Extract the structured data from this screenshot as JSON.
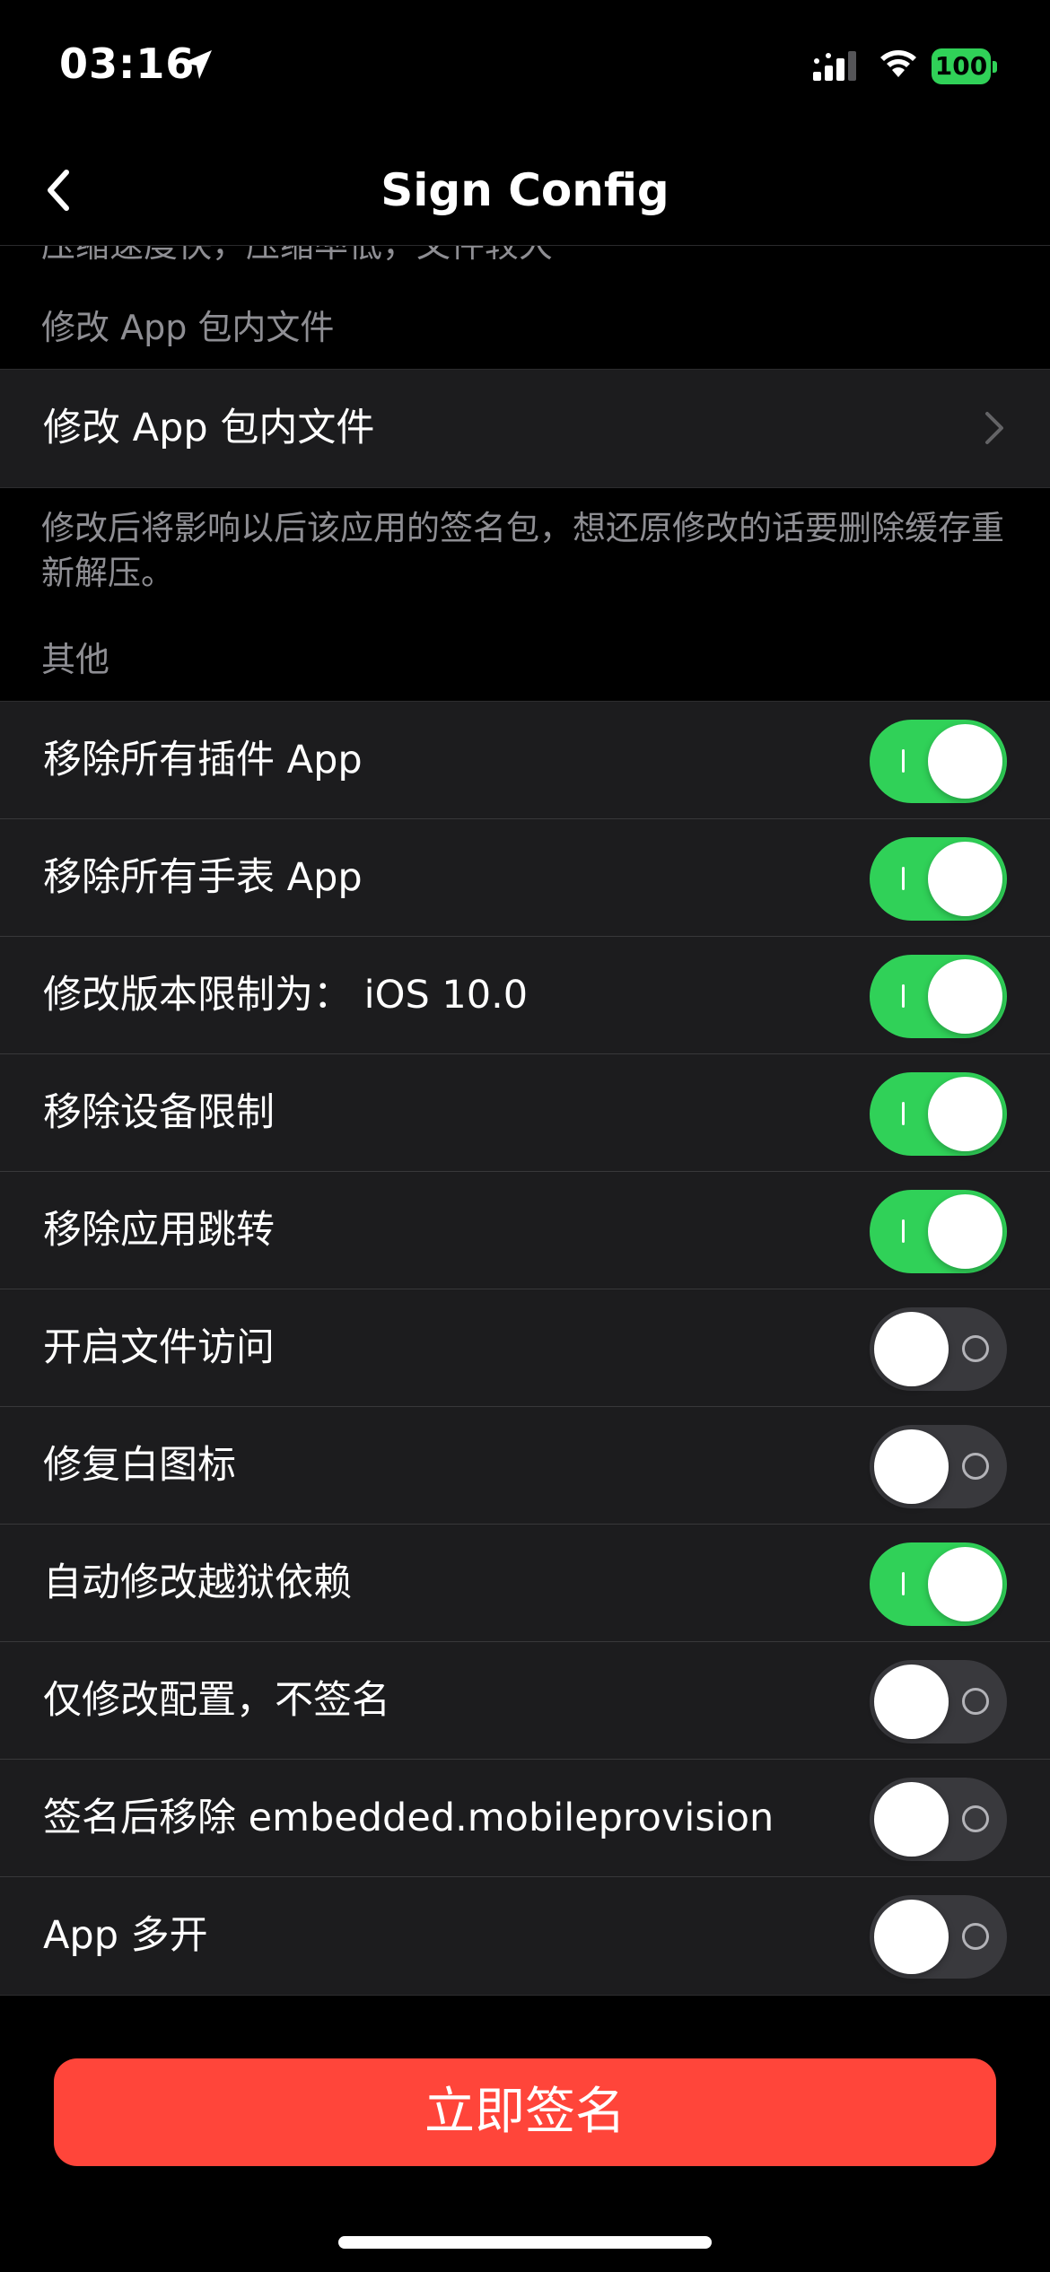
{
  "status_bar": {
    "time": "03:16",
    "battery": "100",
    "battery_color": "#30d158"
  },
  "nav": {
    "title": "Sign Config",
    "back_icon": "chevron-left-icon"
  },
  "sections": {
    "previous_footer": "压缩速度快，压缩率低，文件较大",
    "modify_header": "修改 App 包内文件",
    "modify_row_label": "修改 App 包内文件",
    "modify_footer": "修改后将影响以后该应用的签名包，想还原修改的话要删除缓存重新解压。",
    "other_header": "其他"
  },
  "rows": [
    {
      "label": "移除所有插件 App",
      "on": true
    },
    {
      "label": "移除所有手表 App",
      "on": true
    },
    {
      "label": "修改版本限制为： iOS 10.0",
      "on": true
    },
    {
      "label": "移除设备限制",
      "on": true
    },
    {
      "label": "移除应用跳转",
      "on": true
    },
    {
      "label": "开启文件访问",
      "on": false
    },
    {
      "label": "修复白图标",
      "on": false
    },
    {
      "label": "自动修改越狱依赖",
      "on": true
    },
    {
      "label": "仅修改配置，不签名",
      "on": false
    },
    {
      "label": "签名后移除 embedded.mobileprovision",
      "on": false
    },
    {
      "label": "App 多开",
      "on": false
    }
  ],
  "actions": {
    "sign_button": "立即签名",
    "sign_button_color": "#ff453a"
  },
  "colors": {
    "toggle_on": "#30d158",
    "toggle_off": "#39393d",
    "cell_background": "#1c1c1e",
    "secondary_text": "#8e8e93"
  }
}
